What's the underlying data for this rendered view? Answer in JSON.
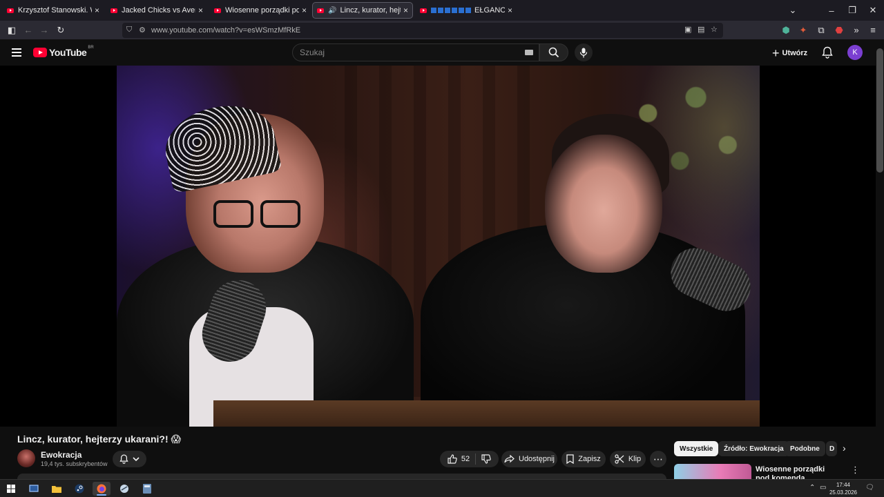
{
  "browser": {
    "tabs": [
      {
        "title": "Krzysztof Stanowski. W jakiej sp",
        "active": false
      },
      {
        "title": "Jacked Chicks vs Average Joes |",
        "active": false
      },
      {
        "title": "Wiosenne porządki pod komen",
        "active": false
      },
      {
        "title": "Lincz, kurator, hejterzy ukar",
        "active": true
      },
      {
        "title": "EŁGANOWO: D",
        "active": false
      }
    ],
    "url": "www.youtube.com/watch?v=esWSmzMfRkE"
  },
  "youtube": {
    "logo_text": "YouTube",
    "logo_country": "BR",
    "search_placeholder": "Szukaj",
    "create_label": "Utwórz",
    "avatar_letter": "K"
  },
  "video": {
    "title": "Lincz, kurator, hejterzy ukarani?! 😱",
    "channel_name": "Ewokracja",
    "subscribers": "19,4 tys. subskrybentów",
    "like_count": "52",
    "share_label": "Udostępnij",
    "save_label": "Zapisz",
    "clip_label": "Klip"
  },
  "sidebar": {
    "chips": [
      "Wszystkie",
      "Źródło: Ewokracja",
      "Podobne",
      "D"
    ],
    "recommendation_title": "Wiosenne porządki pod komenda"
  },
  "taskbar": {
    "time": "17:44",
    "date": "25.03.2026"
  },
  "colors": {
    "yt_red": "#ff0033",
    "bg": "#0f0f0f",
    "pill": "#272727",
    "avatar": "#7b3fd1"
  }
}
